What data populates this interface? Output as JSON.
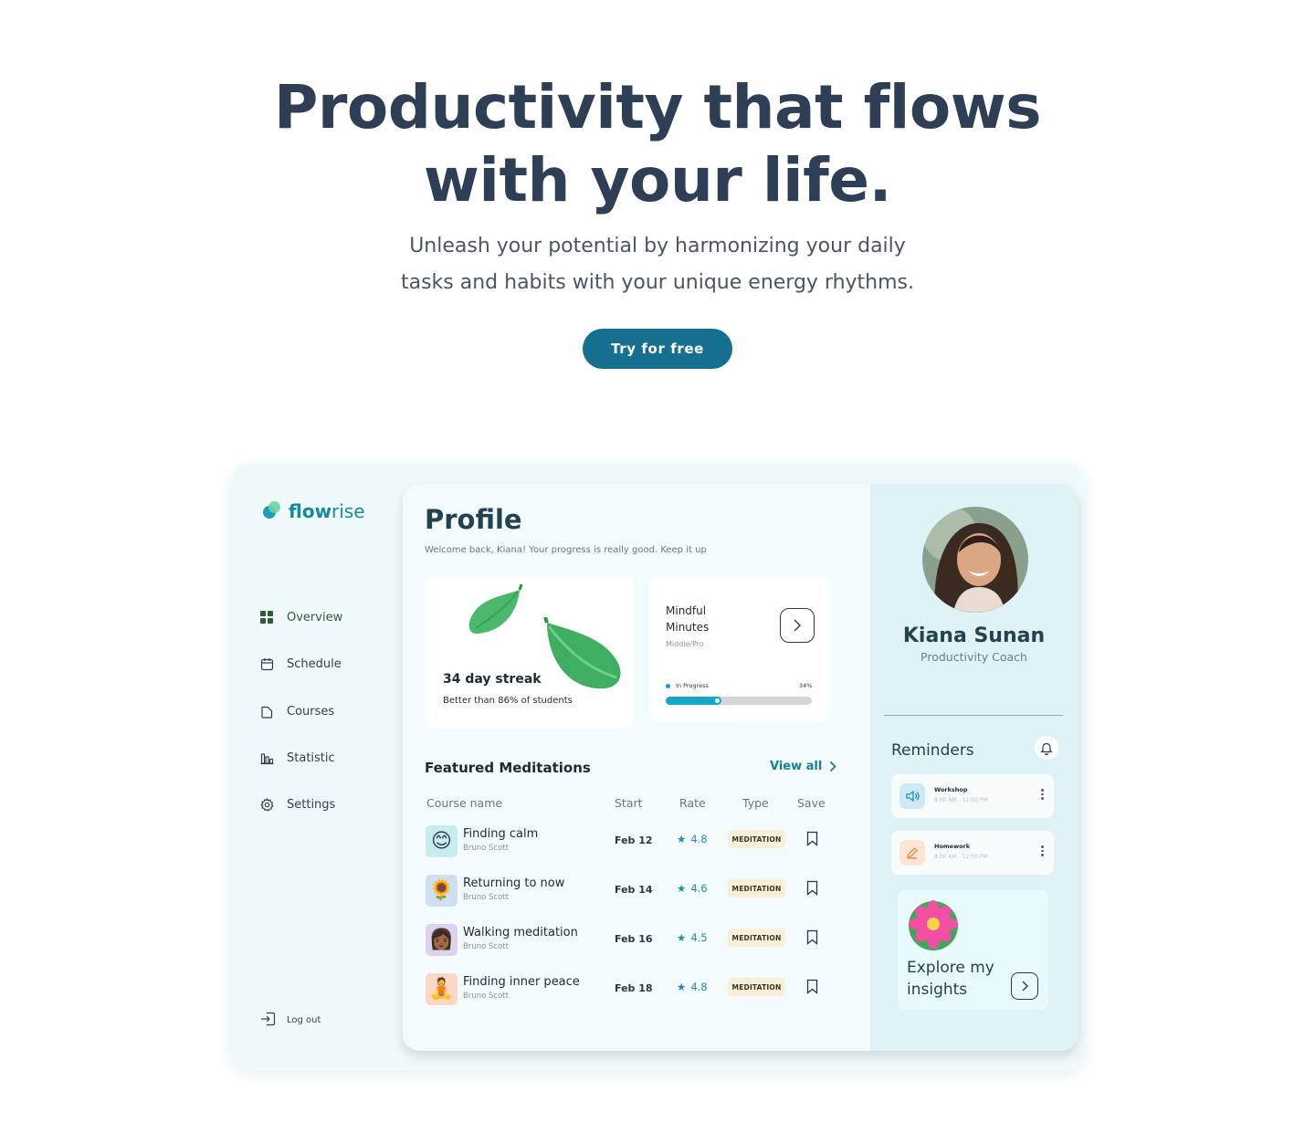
{
  "hero": {
    "title_line1": "Productivity that flows",
    "title_line2": "with your life.",
    "subtitle_line1": "Unleash your potential by harmonizing your daily",
    "subtitle_line2": "tasks and habits with your unique energy rhythms.",
    "cta_label": "Try for free"
  },
  "brand": {
    "name_bold": "flow",
    "name_light": "rise",
    "accent": "#178a93"
  },
  "sidebar": {
    "items": [
      {
        "label": "Overview",
        "icon": "grid-icon",
        "active": true
      },
      {
        "label": "Schedule",
        "icon": "calendar-icon"
      },
      {
        "label": "Courses",
        "icon": "folder-icon"
      },
      {
        "label": "Statistic",
        "icon": "bar-chart-icon"
      },
      {
        "label": "Settings",
        "icon": "gear-icon"
      }
    ],
    "logout_label": "Log out"
  },
  "profile": {
    "title": "Profile",
    "welcome": "Welcome back, Kiana! Your progress is really good. Keep it up"
  },
  "streak": {
    "title": "34 day streak",
    "subtitle": "Better than 86% of students"
  },
  "mindful": {
    "title": "Mindful Minutes",
    "level": "Middle/Pro",
    "status": "In Progress",
    "percent_label": "34%",
    "progress": 0.38
  },
  "featured": {
    "title": "Featured Meditations",
    "view_all": "View all",
    "columns": [
      "Course name",
      "Start",
      "Rate",
      "Type",
      "Save"
    ],
    "rows": [
      {
        "name": "Finding calm",
        "author": "Bruno Scott",
        "start": "Feb 12",
        "rate": "4.8",
        "type": "MEDITATION",
        "thumb": "😊",
        "thumb_bg": "#c9ecee"
      },
      {
        "name": "Returning to now",
        "author": "Bruno Scott",
        "start": "Feb 14",
        "rate": "4.6",
        "type": "MEDITATION",
        "thumb": "🌻",
        "thumb_bg": "#cfe0f3"
      },
      {
        "name": "Walking meditation",
        "author": "Bruno Scott",
        "start": "Feb 16",
        "rate": "4.5",
        "type": "MEDITATION",
        "thumb": "👩🏾",
        "thumb_bg": "#ddd3ef"
      },
      {
        "name": "Finding inner peace",
        "author": "Bruno Scott",
        "start": "Feb 18",
        "rate": "4.8",
        "type": "MEDITATION",
        "thumb": "🧘",
        "thumb_bg": "#fbd8c6"
      }
    ]
  },
  "user": {
    "name": "Kiana Sunan",
    "role": "Productivity Coach"
  },
  "reminders": {
    "title": "Reminders",
    "items": [
      {
        "title": "Workshop",
        "time": "8:00 AM - 12:00 PM",
        "icon": "speaker-icon",
        "bg": "#cdeaf2",
        "color": "#2a8fb1"
      },
      {
        "title": "Homework",
        "time": "8:00 AM - 12:00 PM",
        "icon": "pencil-icon",
        "bg": "#fde5d3",
        "color": "#e58a44"
      }
    ]
  },
  "insights": {
    "label": "Explore my insights"
  }
}
